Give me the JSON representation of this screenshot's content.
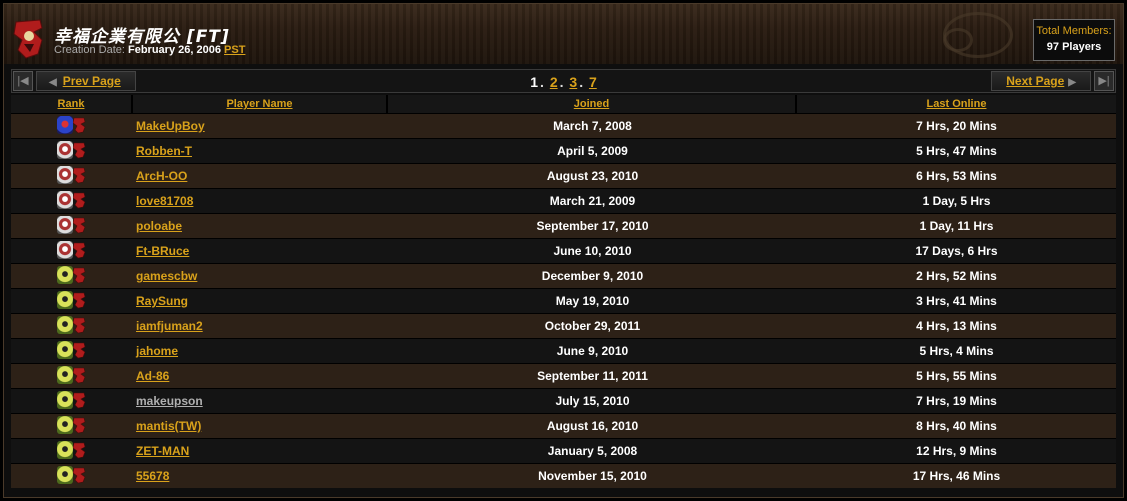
{
  "header": {
    "clan_name": "幸福企業有限公",
    "clan_tag": "[FT]",
    "creation_label": "Creation Date:",
    "creation_date": "February 26, 2006",
    "timezone": "PST",
    "members_label": "Total Members:",
    "members_count": "97 Players"
  },
  "pager": {
    "prev_label": "Prev Page",
    "next_label": "Next Page",
    "current": "1",
    "pages": [
      "2",
      "3",
      "7"
    ]
  },
  "table": {
    "headers": {
      "rank": "Rank",
      "name": "Player Name",
      "joined": "Joined",
      "last": "Last Online"
    },
    "rows": [
      {
        "rank_icon": "rank-1-icon",
        "name": "MakeUpBoy",
        "joined": "March 7, 2008",
        "last": "7 Hrs, 20 Mins"
      },
      {
        "rank_icon": "rank-2-icon",
        "name": "Robben-T",
        "joined": "April 5, 2009",
        "last": "5 Hrs, 47 Mins"
      },
      {
        "rank_icon": "rank-2-icon",
        "name": "ArcH-OO",
        "joined": "August 23, 2010",
        "last": "6 Hrs, 53 Mins"
      },
      {
        "rank_icon": "rank-2-icon",
        "name": "love81708",
        "joined": "March 21, 2009",
        "last": "1 Day, 5 Hrs"
      },
      {
        "rank_icon": "rank-2-icon",
        "name": "poloabe",
        "joined": "September 17, 2010",
        "last": "1 Day, 11 Hrs"
      },
      {
        "rank_icon": "rank-2-icon",
        "name": "Ft-BRuce",
        "joined": "June 10, 2010",
        "last": "17 Days, 6 Hrs"
      },
      {
        "rank_icon": "rank-3-icon",
        "name": "gamescbw",
        "joined": "December 9, 2010",
        "last": "2 Hrs, 52 Mins"
      },
      {
        "rank_icon": "rank-3-icon",
        "name": "RaySung",
        "joined": "May 19, 2010",
        "last": "3 Hrs, 41 Mins"
      },
      {
        "rank_icon": "rank-3-icon",
        "name": "iamfjuman2",
        "joined": "October 29, 2011",
        "last": "4 Hrs, 13 Mins"
      },
      {
        "rank_icon": "rank-3-icon",
        "name": "jahome",
        "joined": "June 9, 2010",
        "last": "5 Hrs, 4 Mins"
      },
      {
        "rank_icon": "rank-3-icon",
        "name": "Ad-86",
        "joined": "September 11, 2011",
        "last": "5 Hrs, 55 Mins"
      },
      {
        "rank_icon": "rank-3-icon",
        "name": "makeupson",
        "joined": "July 15, 2010",
        "last": "7 Hrs, 19 Mins"
      },
      {
        "rank_icon": "rank-3-icon",
        "name": "mantis(TW)",
        "joined": "August 16, 2010",
        "last": "8 Hrs, 40 Mins"
      },
      {
        "rank_icon": "rank-3-icon",
        "name": "ZET-MAN",
        "joined": "January 5, 2008",
        "last": "12 Hrs, 9 Mins"
      },
      {
        "rank_icon": "rank-3-icon",
        "name": "55678",
        "joined": "November 15, 2010",
        "last": "17 Hrs, 46 Mins"
      }
    ]
  },
  "colors": {
    "accent": "#d9a21b",
    "row_odd": "#2d2117",
    "row_even": "#141414"
  }
}
